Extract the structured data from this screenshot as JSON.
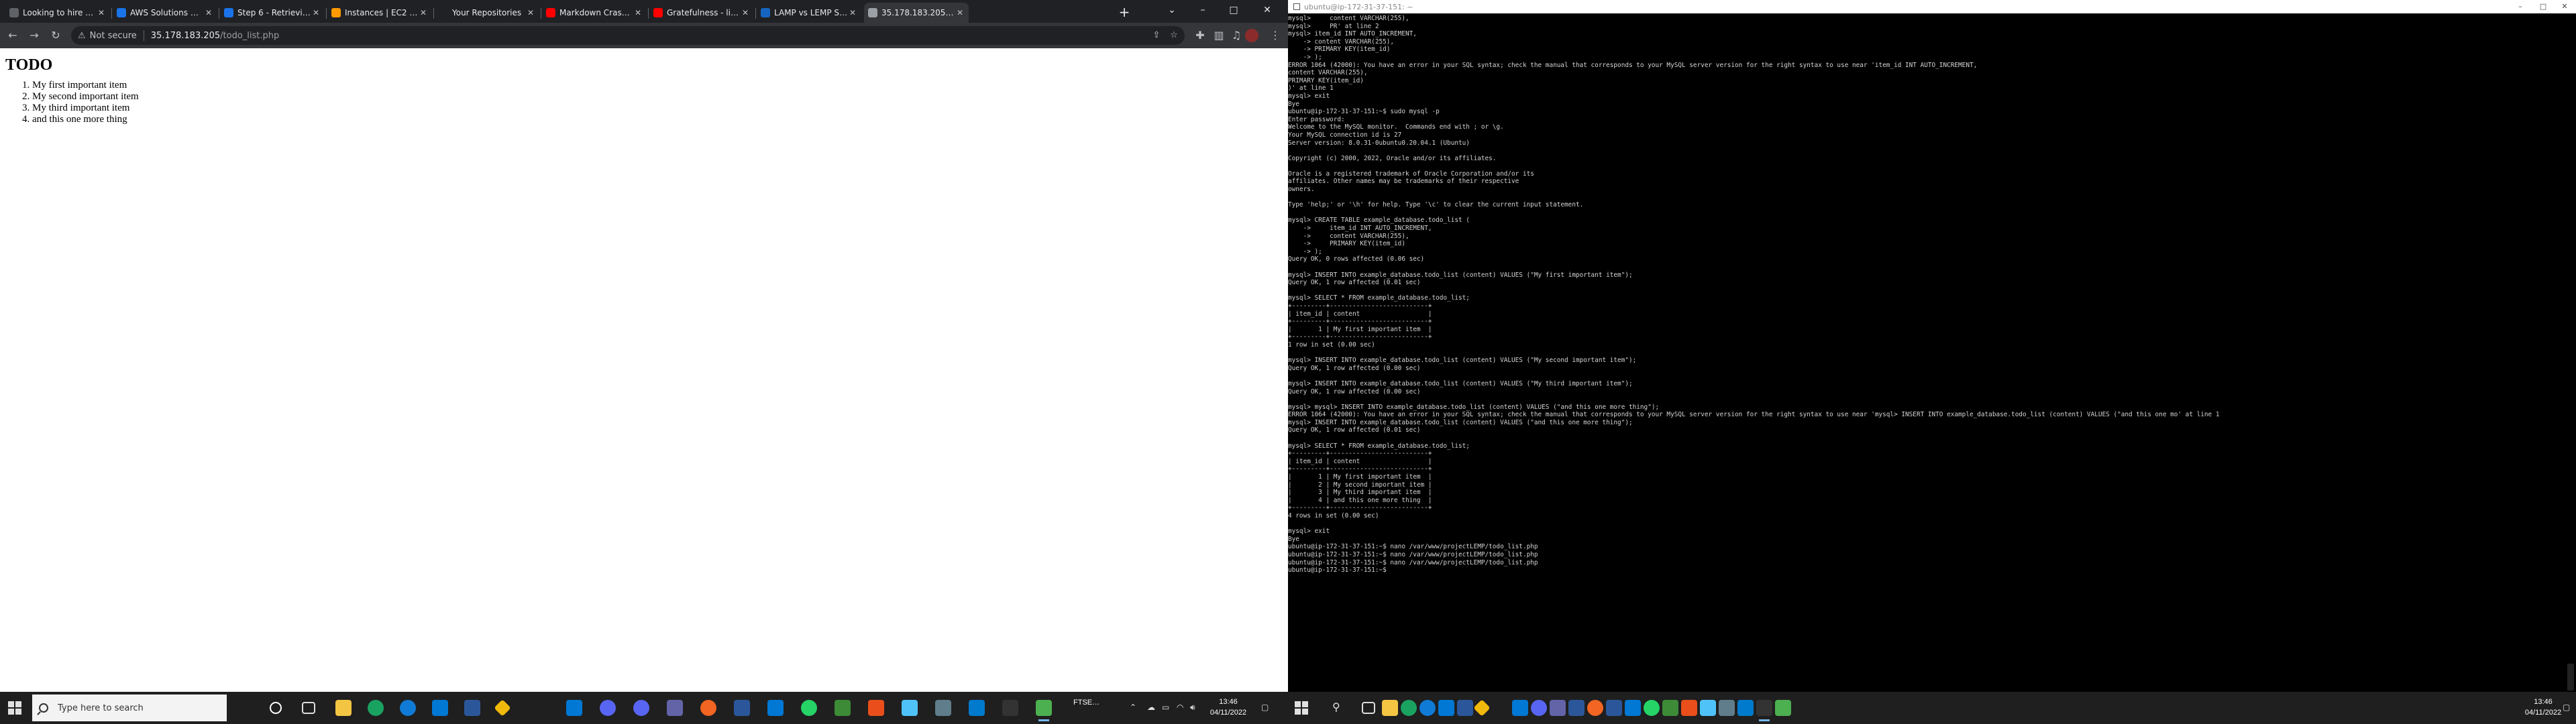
{
  "browser": {
    "tabs": [
      {
        "label": "Looking to hire AWS / …",
        "color": "#5f6368"
      },
      {
        "label": "AWS Solutions Archit…",
        "color": "#1a73e8"
      },
      {
        "label": "Step 6 - Retrieving da…",
        "color": "#1a73e8"
      },
      {
        "label": "Instances | EC2 Mana…",
        "color": "#ff9900"
      },
      {
        "label": "Your Repositories",
        "color": "#202124"
      },
      {
        "label": "Markdown Crash Cou…",
        "color": "#ff0000"
      },
      {
        "label": "Gratefulness - live pro…",
        "color": "#ff0000"
      },
      {
        "label": "LAMP vs LEMP Stack",
        "color": "#1565c0"
      },
      {
        "label": "35.178.183.205/todo…",
        "color": "#9aa0a6"
      }
    ],
    "address": {
      "security_label": "Not secure",
      "host": "35.178.183.205",
      "path": "/todo_list.php"
    }
  },
  "page": {
    "heading": "TODO",
    "items": [
      "My first important item",
      "My second important item",
      "My third important item",
      "and this one more thing"
    ]
  },
  "terminal": {
    "title": "ubuntu@ip-172-31-37-151: ~",
    "lines": [
      "mysql>     content VARCHAR(255),",
      "mysql>     PR' at line 2",
      "mysql> item_id INT AUTO_INCREMENT,",
      "    -> content VARCHAR(255),",
      "    -> PRIMARY KEY(item_id)",
      "    -> );",
      "ERROR 1064 (42000): You have an error in your SQL syntax; check the manual that corresponds to your MySQL server version for the right syntax to use near 'item_id INT AUTO_INCREMENT,",
      "content VARCHAR(255),",
      "PRIMARY KEY(item_id)",
      ")' at line 1",
      "mysql> exit",
      "Bye",
      "ubuntu@ip-172-31-37-151:~$ sudo mysql -p",
      "Enter password:",
      "Welcome to the MySQL monitor.  Commands end with ; or \\g.",
      "Your MySQL connection id is 27",
      "Server version: 8.0.31-0ubuntu0.20.04.1 (Ubuntu)",
      "",
      "Copyright (c) 2000, 2022, Oracle and/or its affiliates.",
      "",
      "Oracle is a registered trademark of Oracle Corporation and/or its",
      "affiliates. Other names may be trademarks of their respective",
      "owners.",
      "",
      "Type 'help;' or '\\h' for help. Type '\\c' to clear the current input statement.",
      "",
      "mysql> CREATE TABLE example_database.todo_list (",
      "    ->     item_id INT AUTO_INCREMENT,",
      "    ->     content VARCHAR(255),",
      "    ->     PRIMARY KEY(item_id)",
      "    -> );",
      "Query OK, 0 rows affected (0.06 sec)",
      "",
      "mysql> INSERT INTO example_database.todo_list (content) VALUES (\"My first important item\");",
      "Query OK, 1 row affected (0.01 sec)",
      "",
      "mysql> SELECT * FROM example_database.todo_list;",
      "+---------+--------------------------+",
      "| item_id | content                  |",
      "+---------+--------------------------+",
      "|       1 | My first important item  |",
      "+---------+--------------------------+",
      "1 row in set (0.00 sec)",
      "",
      "mysql> INSERT INTO example_database.todo_list (content) VALUES (\"My second important item\");",
      "Query OK, 1 row affected (0.00 sec)",
      "",
      "mysql> INSERT INTO example_database.todo_list (content) VALUES (\"My third important item\");",
      "Query OK, 1 row affected (0.00 sec)",
      "",
      "mysql> mysql> INSERT INTO example_database.todo_list (content) VALUES (\"and this one more thing\");",
      "ERROR 1064 (42000): You have an error in your SQL syntax; check the manual that corresponds to your MySQL server version for the right syntax to use near 'mysql> INSERT INTO example_database.todo_list (content) VALUES (\"and this one mo' at line 1",
      "mysql> INSERT INTO example_database.todo_list (content) VALUES (\"and this one more thing\");",
      "Query OK, 1 row affected (0.01 sec)",
      "",
      "mysql> SELECT * FROM example_database.todo_list;",
      "+---------+--------------------------+",
      "| item_id | content                  |",
      "+---------+--------------------------+",
      "|       1 | My first important item  |",
      "|       2 | My second important item |",
      "|       3 | My third important item  |",
      "|       4 | and this one more thing  |",
      "+---------+--------------------------+",
      "4 rows in set (0.00 sec)",
      "",
      "mysql> exit",
      "Bye",
      "ubuntu@ip-172-31-37-151:~$ nano /var/www/projectLEMP/todo_list.php",
      "ubuntu@ip-172-31-37-151:~$ nano /var/www/projectLEMP/todo_list.php",
      "ubuntu@ip-172-31-37-151:~$ nano /var/www/projectLEMP/todo_list.php",
      "ubuntu@ip-172-31-37-151:~$ "
    ]
  },
  "taskbar_left": {
    "search_placeholder": "Type here to search",
    "stock_name": "FTSE…",
    "clock_time": "13:46",
    "clock_date": "04/11/2022"
  },
  "taskbar_right": {
    "clock_time": "13:46",
    "clock_date": "04/11/2022"
  }
}
